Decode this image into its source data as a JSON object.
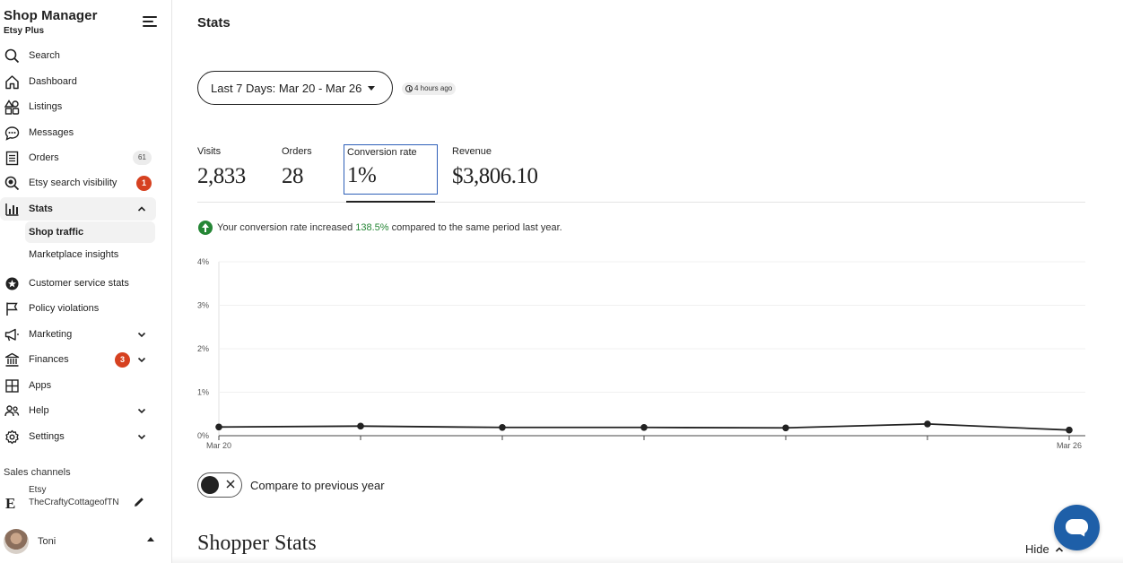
{
  "sidebar": {
    "title": "Shop Manager",
    "subtitle": "Etsy Plus",
    "items": [
      {
        "label": "Search",
        "icon": "search-icon"
      },
      {
        "label": "Dashboard",
        "icon": "home-icon"
      },
      {
        "label": "Listings",
        "icon": "shapes-icon"
      },
      {
        "label": "Messages",
        "icon": "chat-bubble-icon"
      },
      {
        "label": "Orders",
        "icon": "receipt-icon",
        "badge": "61"
      },
      {
        "label": "Etsy search visibility",
        "icon": "search-visibility-icon",
        "badge": "1"
      },
      {
        "label": "Stats",
        "icon": "bar-chart-icon"
      },
      {
        "label": "Customer service stats",
        "icon": "star-badge-icon"
      },
      {
        "label": "Policy violations",
        "icon": "flag-icon"
      },
      {
        "label": "Marketing",
        "icon": "megaphone-icon"
      },
      {
        "label": "Finances",
        "icon": "bank-icon",
        "badge": "3"
      },
      {
        "label": "Apps",
        "icon": "grid-icon"
      },
      {
        "label": "Help",
        "icon": "people-icon"
      },
      {
        "label": "Settings",
        "icon": "gear-icon"
      }
    ],
    "stats_sub": [
      {
        "label": "Shop traffic"
      },
      {
        "label": "Marketplace insights"
      }
    ],
    "sales_channels_label": "Sales channels",
    "channel": {
      "name": "Etsy",
      "shop": "TheCraftyCottageofTN"
    },
    "user": {
      "name": "Toni"
    }
  },
  "main": {
    "title": "Stats",
    "date_range": "Last 7 Days: Mar 20 - Mar 26",
    "updated": "4 hours ago",
    "metrics": [
      {
        "label": "Visits",
        "value": "2,833"
      },
      {
        "label": "Orders",
        "value": "28"
      },
      {
        "label": "Conversion rate",
        "value": "1%"
      },
      {
        "label": "Revenue",
        "value": "$3,806.10"
      }
    ],
    "insight": {
      "before": "Your conversion rate increased",
      "pct": "138.5%",
      "after": "compared to the same period last year."
    },
    "compare_label": "Compare to previous year",
    "shopper_stats": "Shopper Stats",
    "hide_label": "Hide"
  },
  "chart_data": {
    "type": "line",
    "x": [
      "Mar 20",
      "Mar 21",
      "Mar 22",
      "Mar 23",
      "Mar 24",
      "Mar 25",
      "Mar 26"
    ],
    "x_tick_labels": [
      "Mar 20",
      "Mar 26"
    ],
    "series": [
      {
        "values": [
          0.2,
          0.22,
          0.19,
          0.19,
          0.18,
          0.27,
          0.13
        ]
      }
    ],
    "y_ticks": [
      "0%",
      "1%",
      "2%",
      "3%",
      "4%"
    ],
    "ylim": [
      0,
      4
    ],
    "grid": true,
    "color": "#222222"
  },
  "colors": {
    "badge_red": "#d64120",
    "positive_green": "#258635",
    "selected_border": "#2e5fb8",
    "chat_button": "#1e5fa8"
  }
}
